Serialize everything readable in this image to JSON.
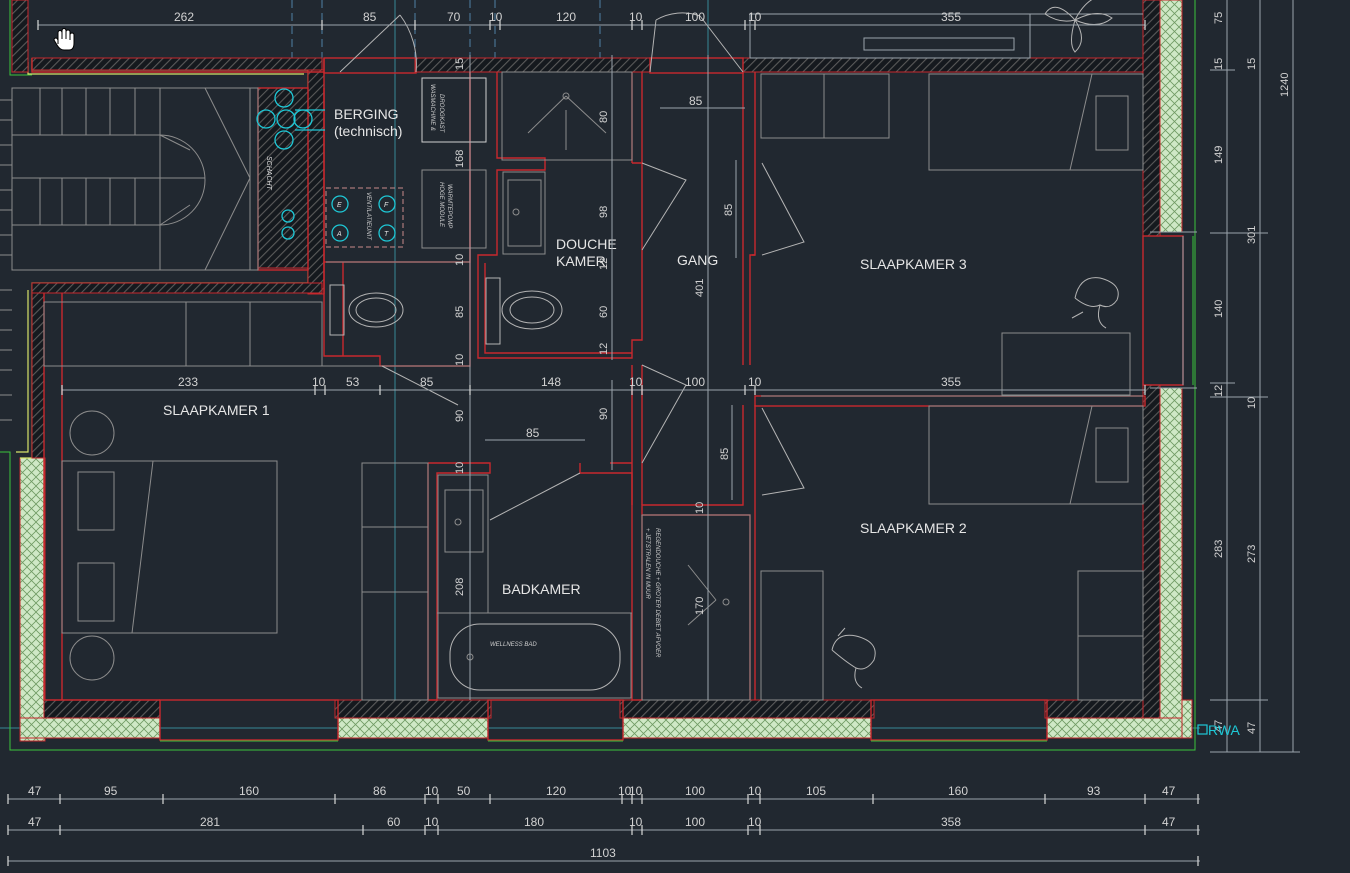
{
  "rooms": {
    "berging": "BERGING",
    "berging_sub": "(technisch)",
    "schacht": "SCHACHT",
    "douche_1": "DOUCHE",
    "douche_2": "KAMER",
    "gang": "GANG",
    "slaapkamer_1": "SLAAPKAMER 1",
    "slaapkamer_2": "SLAAPKAMER 2",
    "slaapkamer_3": "SLAAPKAMER 3",
    "badkamer": "BADKAMER"
  },
  "fixtures": {
    "wasmachine_1": "WASMACHINE &",
    "wasmachine_2": "DROOGKAST",
    "warmtepomp_1": "WARMTEPOMP",
    "warmtepomp_2": "HOGE MODULE",
    "ventilatie": "VENTILATIEUNIT",
    "wellness": "WELLNESS BAD",
    "regendouche_1": "REGENDOUCHE + GROTER DEBIET AFVOER",
    "regendouche_2": "+ JETSTRALEN IN MUUR",
    "port_e": "E",
    "port_f": "F",
    "port_a": "A",
    "port_t": "T"
  },
  "dims_top": [
    "262",
    "85",
    "70",
    "10",
    "120",
    "10",
    "100",
    "10",
    "355"
  ],
  "dims_row2": [
    "233",
    "10",
    "53",
    "85",
    "148",
    "10",
    "100",
    "10",
    "355"
  ],
  "dims_inner": [
    "85",
    "85",
    "85",
    "85"
  ],
  "dims_vertical": [
    "15",
    "80",
    "168",
    "98",
    "10",
    "12",
    "85",
    "60",
    "12",
    "10",
    "401",
    "90",
    "90",
    "10",
    "208",
    "10",
    "170",
    "85",
    "85"
  ],
  "dims_right_a": [
    "75",
    "15",
    "149",
    "140",
    "12",
    "283",
    "47"
  ],
  "dims_right_b": [
    "15",
    "301",
    "10",
    "273",
    "47"
  ],
  "dims_right_c": "1240",
  "dims_bottom_1": [
    "47",
    "95",
    "160",
    "86",
    "10",
    "50",
    "120",
    "10",
    "10",
    "100",
    "10",
    "105",
    "160",
    "93",
    "47"
  ],
  "dims_bottom_2": [
    "47",
    "281",
    "60",
    "10",
    "180",
    "10",
    "100",
    "10",
    "358",
    "47"
  ],
  "dims_bottom_3": "1103",
  "rwa": "RWA",
  "cursor_icon": "hand-cursor-icon",
  "colors": {
    "background": "#212830",
    "wall": "#c8282d",
    "insulation": "#3cc43c",
    "service": "#1ec8d6",
    "dimension": "#d2d2d2"
  }
}
